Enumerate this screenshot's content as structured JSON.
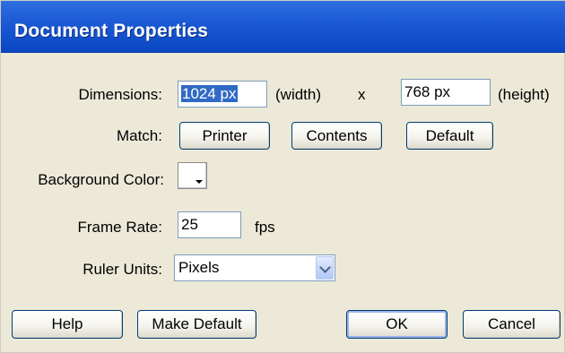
{
  "title": "Document Properties",
  "dimensions": {
    "label": "Dimensions:",
    "width_value": "1024 px",
    "width_unit": "(width)",
    "separator": "x",
    "height_value": "768 px",
    "height_unit": "(height)"
  },
  "match": {
    "label": "Match:",
    "printer": "Printer",
    "contents": "Contents",
    "default": "Default"
  },
  "background": {
    "label": "Background Color:",
    "color": "#ffffff"
  },
  "frame_rate": {
    "label": "Frame Rate:",
    "value": "25",
    "unit": "fps"
  },
  "ruler": {
    "label": "Ruler Units:",
    "value": "Pixels"
  },
  "buttons": {
    "help": "Help",
    "make_default": "Make Default",
    "ok": "OK",
    "cancel": "Cancel"
  },
  "icons": {
    "swatch_arrow": "dropdown-arrow-icon",
    "select_chevron": "chevron-down-icon"
  }
}
